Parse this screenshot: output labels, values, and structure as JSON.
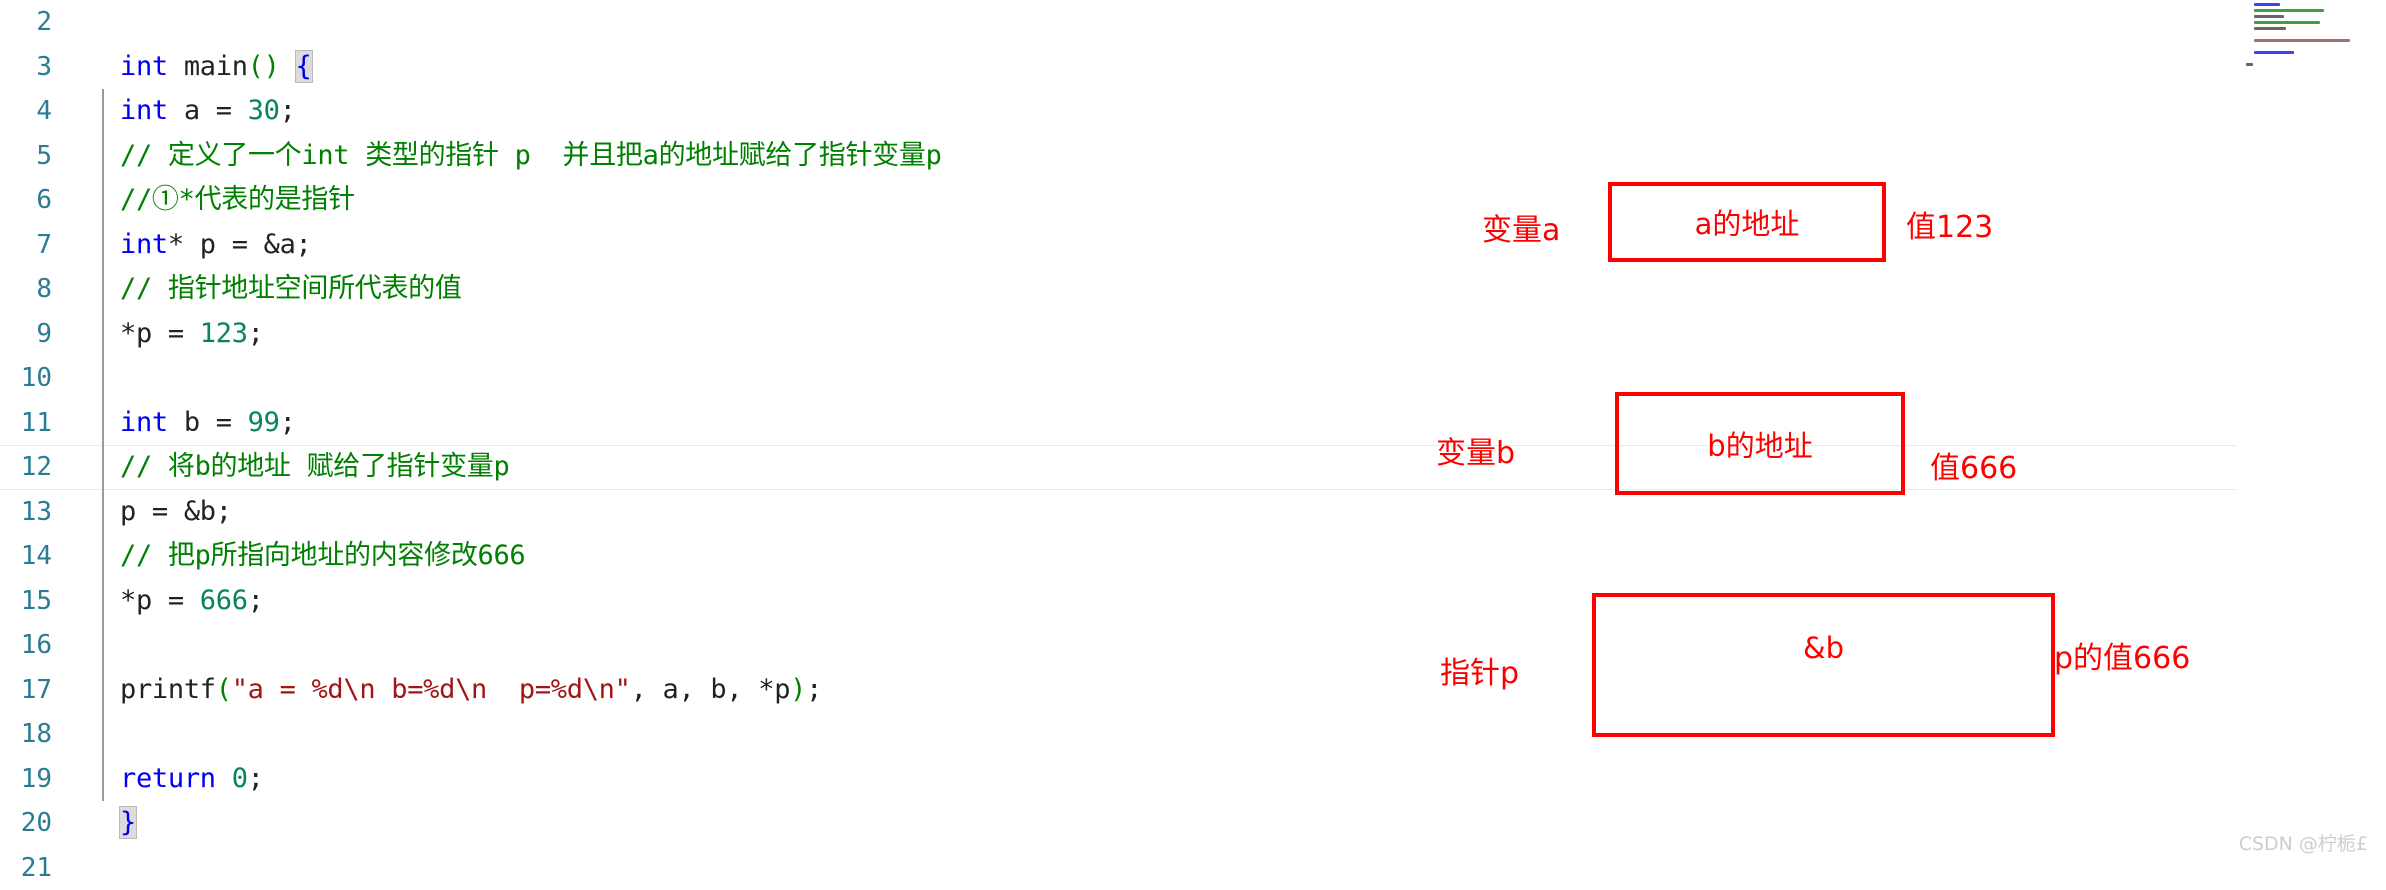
{
  "editor": {
    "language": "c",
    "first_visible_line": 2,
    "active_line": 12,
    "lines": [
      {
        "number": "2",
        "text": ""
      },
      {
        "number": "3",
        "text": "int main() {"
      },
      {
        "number": "4",
        "text": "    int a = 30;"
      },
      {
        "number": "5",
        "text": "    // 定义了一个int 类型的指针 p  并且把a的地址赋给了指针变量p"
      },
      {
        "number": "6",
        "text": "    //①*代表的是指针"
      },
      {
        "number": "7",
        "text": "    int* p = &a;"
      },
      {
        "number": "8",
        "text": "    // 指针地址空间所代表的值"
      },
      {
        "number": "9",
        "text": "    *p = 123;"
      },
      {
        "number": "10",
        "text": ""
      },
      {
        "number": "11",
        "text": "    int b = 99;"
      },
      {
        "number": "12",
        "text": "    // 将b的地址 赋给了指针变量p"
      },
      {
        "number": "13",
        "text": "    p = &b;"
      },
      {
        "number": "14",
        "text": "    // 把p所指向地址的内容修改666"
      },
      {
        "number": "15",
        "text": "    *p = 666;"
      },
      {
        "number": "16",
        "text": ""
      },
      {
        "number": "17",
        "text": "    printf(\"a = %d\\n b=%d\\n  p=%d\\n\", a, b, *p);"
      },
      {
        "number": "18",
        "text": ""
      },
      {
        "number": "19",
        "text": "    return 0;"
      },
      {
        "number": "20",
        "text": "}"
      },
      {
        "number": "21",
        "text": ""
      }
    ],
    "colors": {
      "keyword": "#0000F0",
      "number": "#098658",
      "comment": "#008000",
      "string": "#A31515",
      "line_number": "#2A7C93",
      "active_line_border": "#EAEAEA",
      "brace_match_bg": "#DCDCDC"
    }
  },
  "annotations": {
    "accent_color": "#FF0000",
    "groups": [
      {
        "id": "variable-a",
        "left_label": "变量a",
        "box_label": "a的地址",
        "right_label": "值123"
      },
      {
        "id": "variable-b",
        "left_label": "变量b",
        "box_label": "b的地址",
        "right_label": "值666"
      },
      {
        "id": "pointer-p",
        "left_label": "指针p",
        "box_label": "&b",
        "right_label": "p的值666"
      }
    ]
  },
  "watermark": {
    "text": "CSDN @柠栀£"
  }
}
